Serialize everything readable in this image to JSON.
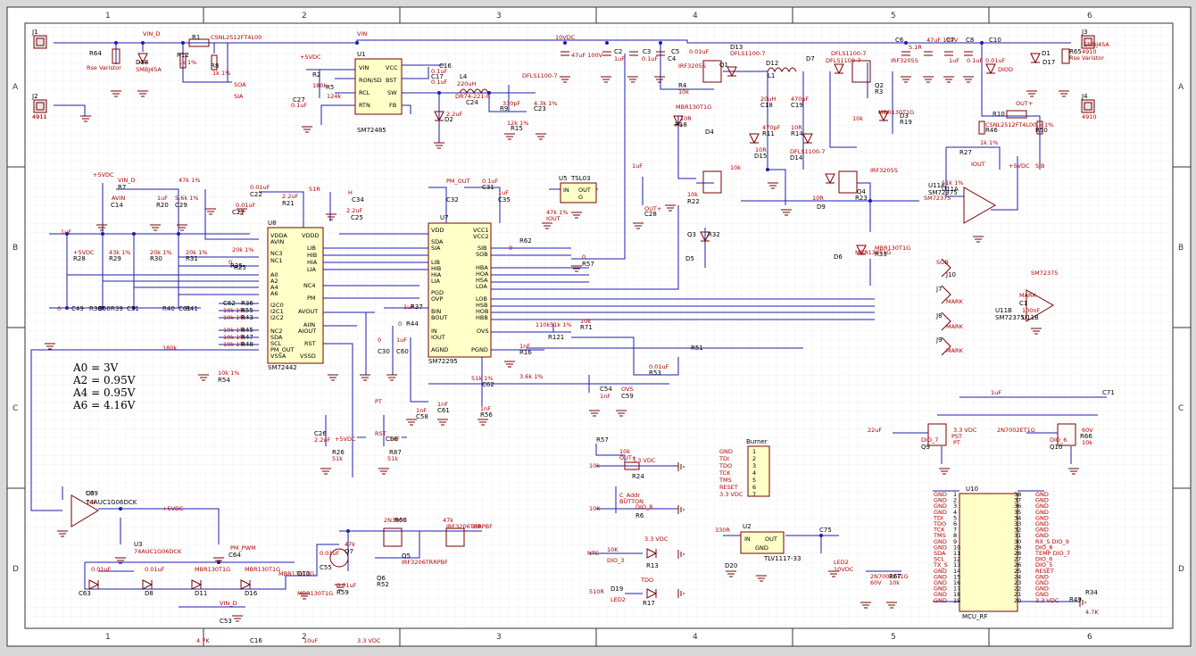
{
  "sheet": {
    "col_labels": [
      "1",
      "2",
      "3",
      "4",
      "5",
      "6"
    ],
    "row_labels": [
      "A",
      "B",
      "C",
      "D"
    ]
  },
  "colors": {
    "wire": "#1c1cb0",
    "part": "#7a0000",
    "label": "#b30000",
    "chip": "#ffffc8"
  },
  "notes": [
    "A0 = 3V",
    "A2 = 0.95V",
    "A4 = 0.95V",
    "A6 = 4.16V"
  ],
  "chips": {
    "u1": {
      "ref": "U1",
      "name": "SM72485",
      "pins": [
        "VIN",
        "RON/SD",
        "RCL",
        "RTN",
        "VCC",
        "BST",
        "SW",
        "FB"
      ]
    },
    "u8": {
      "ref": "U8",
      "name": "SM72442",
      "pins": [
        "VDDA",
        "AVIN",
        "NC3",
        "NC1",
        "A0",
        "A2",
        "A4",
        "A6",
        "I2C0",
        "I2C1",
        "I2C2",
        "NC2",
        "SDA",
        "SCL",
        "PM_OUT",
        "VSSA",
        "VDDD",
        "LIB",
        "HIB",
        "HIA",
        "LIA",
        "NC4",
        "PM",
        "AVOUT",
        "AIIN",
        "AIOUT",
        "RST",
        "VSSD"
      ]
    },
    "u7": {
      "ref": "U7",
      "name": "SM72295",
      "pins": [
        "VDD",
        "SDA",
        "SIA",
        "LIB",
        "HIB",
        "HIA",
        "LIA",
        "PGD",
        "OVP",
        "BIN",
        "BOUT",
        "IN",
        "IOUT",
        "AGND",
        "VCC1",
        "VCC2",
        "SIB",
        "SOB",
        "HBA",
        "HOA",
        "HSA",
        "LOA",
        "LOB",
        "HSB",
        "HOB",
        "HBB",
        "OVS",
        "PGND"
      ]
    },
    "u10": {
      "ref": "U10",
      "name": "MCU_RF",
      "left": [
        "GND",
        "GND",
        "GND",
        "GND",
        "TDI",
        "TDO",
        "TCK",
        "TMS",
        "GND",
        "GND",
        "SDA",
        "SCL",
        "TX_S",
        "GND",
        "GND",
        "GND",
        "GND",
        "GND",
        "GND"
      ],
      "right": [
        "GND",
        "GND",
        "GND",
        "GND",
        "GND",
        "GND",
        "GND",
        "GND",
        "RX_S DIO_9",
        "DIO_8",
        "TEMP DIO_7",
        "DIO_6",
        "DIO_5",
        "RESET",
        "GND",
        "GND",
        "GND",
        "GND",
        "3.3 VDC"
      ],
      "pin_left": [
        "1",
        "2",
        "3",
        "4",
        "5",
        "6",
        "7",
        "8",
        "9",
        "10",
        "11",
        "12",
        "13",
        "14",
        "15",
        "16",
        "17",
        "18",
        "19"
      ],
      "pin_right": [
        "38",
        "37",
        "36",
        "35",
        "34",
        "33",
        "32",
        "31",
        "30",
        "29",
        "28",
        "27",
        "26",
        "25",
        "24",
        "23",
        "22",
        "21",
        "20"
      ]
    },
    "burner": {
      "name": "Burner",
      "pins": [
        "GND",
        "TDI",
        "TDO",
        "TCK",
        "TMS",
        "RESET",
        "3.3 VDC"
      ]
    },
    "u5": {
      "ref": "U5",
      "name": "TSL03",
      "pins": [
        "IN",
        "OUT",
        "G"
      ]
    },
    "u2": {
      "ref": "U2",
      "name": "TLV1117-33",
      "pins": [
        "IN",
        "OUT",
        "GND"
      ]
    },
    "u3": {
      "ref": "U3",
      "name": "74AUC1G06DCK"
    },
    "u11a": {
      "ref": "U11A",
      "name": "SM72375"
    },
    "u11b": {
      "ref": "U11B",
      "name": "SM72375"
    }
  },
  "labels": [
    "J1",
    "4911",
    "J2",
    "4911",
    "J3",
    "4910",
    "J4",
    "4910",
    "R64",
    "Rse Varistor",
    "D18",
    "SMBJ45A",
    "VIN_D",
    "R1",
    "CSNL2512FT4L00",
    "VIN",
    "R12",
    "1k 1%",
    "R8",
    "1k 1%",
    "SOA",
    "SIA",
    "+5VDC",
    "R2",
    "180k",
    "R5",
    "124k",
    "C27",
    "0.1uF",
    "C16",
    "0.1uF",
    "C17",
    "0.1uF",
    "L4",
    "220uH",
    "DR74-221-R",
    "C24",
    "330pF",
    "R9",
    "12k 1%",
    "R15",
    "4.3k 1%",
    "C23",
    "2.2uF",
    "D2",
    "DFLS1100-7",
    "10VDC",
    "47uF 100V",
    "C2",
    "1uF",
    "C3",
    "0.1uF",
    "C4",
    "C5",
    "0.01uF",
    "D13",
    "DFLS1100-7",
    "Q1",
    "IRF3205S",
    "R4",
    "10k",
    "MBR130T1G",
    "R18",
    "10R",
    "D4",
    "D12",
    "L1",
    "20uH",
    "C18",
    "470pF",
    "C19",
    "470pF",
    "R11",
    "10R",
    "R14",
    "10R",
    "D15",
    "DFLS1100-7",
    "D14",
    "DFLS1100-7",
    "D7",
    "DFLS1100-7",
    "IRF3205S",
    "Q2",
    "R3",
    "10k",
    "MBR130T1G",
    "D3",
    "R19",
    "10R",
    "D9",
    "IRF3205S",
    "Q4",
    "R23",
    "10k",
    "R22",
    "10k",
    "Q3",
    "R32",
    "D5",
    "MBR130T1G",
    "D6",
    "MBR130T1G",
    "R33",
    "5.1R",
    "C6",
    "47uF 100V",
    "1uF",
    "C7",
    "0.1uF",
    "C8",
    "0.01uF",
    "C10",
    "DIOD",
    "D1",
    "D17",
    "SMBJ45A",
    "R65",
    "Rse Varistor",
    "OUT+",
    "R10",
    "CSNL2512FT4L00",
    "R46",
    "1k 1%",
    "R50",
    "1k 1%",
    "R27",
    "51k 1%",
    "U11A",
    "SM72375",
    "IOUT",
    "+5VDC",
    "SIB",
    "SOB",
    "J7",
    "J8",
    "J9",
    "J10",
    "MARK",
    "MARK",
    "MARK",
    "MARK",
    "C1",
    "100nF",
    "U11B",
    "SM72375",
    "+5VDC",
    "VIN_D",
    "R7",
    "47k 1%",
    "AVIN",
    "C14",
    "1uF",
    "R20",
    "5.6k 1%",
    "C29",
    "0.01uF",
    "C22",
    "2.2uF",
    "R21",
    "51R",
    "H",
    "C34",
    "2.2uF",
    "C25",
    "0.01uF",
    "C27",
    "1uF",
    "+5VDC",
    "R28",
    "43k 1%",
    "R29",
    "20k 1%",
    "R30",
    "20k 1%",
    "R31",
    "20k 1%",
    "R25",
    "0",
    "R35",
    "0",
    "C49",
    "R38",
    "C50",
    "R39",
    "C51",
    "R40",
    "C61",
    "R41",
    "C62",
    "R36",
    "10k 1%",
    "R55",
    "10k 1%",
    "R43",
    "10k 1%",
    "R45",
    "10k 1%",
    "R47",
    "10k 1%",
    "R48",
    "10k 1%",
    "R54",
    "180k",
    "PM_OUT",
    "C32",
    "0.1uF",
    "C31",
    "1uF",
    "C35",
    "1uF",
    "R37",
    "0",
    "R44",
    "0",
    "R62",
    "0",
    "R57",
    "0",
    "C30",
    "1uF",
    "C60",
    "1nF",
    "C58",
    "1nF",
    "C61",
    "1nF",
    "R56",
    "51k 1%",
    "C62",
    "1nF",
    "R16",
    "51k 1%",
    "R121",
    "10k",
    "R71",
    "110k",
    "C54",
    "1nF",
    "OVS",
    "C59",
    "0.01uF",
    "R53",
    "3.6k 1%",
    "R51",
    "47k 1%",
    "IOUT",
    "OUT+",
    "C28",
    "1uF",
    "C26",
    "2.2uF",
    "+5VDC",
    "R26",
    "51k",
    "RST",
    "C66",
    "1nF",
    "R87",
    "51k",
    "PT",
    "C69",
    "1nF",
    "+5VDC",
    "U3",
    "74AUC1G06DCK",
    "PM_PWM",
    "C64",
    "0.01uF",
    "C63",
    "0.01uF",
    "D8",
    "MBR130T1G",
    "D11",
    "MBR130T1G",
    "D16",
    "MBR130T1G",
    "D10",
    "MBR130T1G",
    "VIN_D",
    "C53",
    "0.01uF",
    "C55",
    "0.01uF",
    "R59",
    "47k",
    "Q7",
    "2N3906",
    "R60",
    "47k",
    "IRF3206TRRPBF",
    "Q5",
    "IRF3206TRRPBF",
    "Q6",
    "R52",
    "10k",
    "R57",
    "10k",
    "OUT+",
    "3.3 VDC",
    "R24",
    "10k",
    "C_Addr",
    "BUTTON",
    "DIO_8",
    "R6",
    "10K",
    "NTC",
    "10K",
    "DIO_3",
    "3.3 VDC",
    "R13",
    "510R",
    "D19",
    "LED2",
    "TDO",
    "R17",
    "330R",
    "D20",
    "LED2",
    "10VDC",
    "C75",
    "1uF",
    "C71",
    "22uF",
    "3.3 VDC",
    "PST",
    "PT",
    "DIO_7",
    "Q9",
    "2N7002ET1G",
    "60V",
    "R66",
    "10k",
    "DIO_6",
    "Q10",
    "2N7002ET1G",
    "60V",
    "R67",
    "10k",
    "R34",
    "4.7K",
    "R49",
    "4.7K",
    "C16",
    "10uF",
    "3.3 VDC"
  ]
}
